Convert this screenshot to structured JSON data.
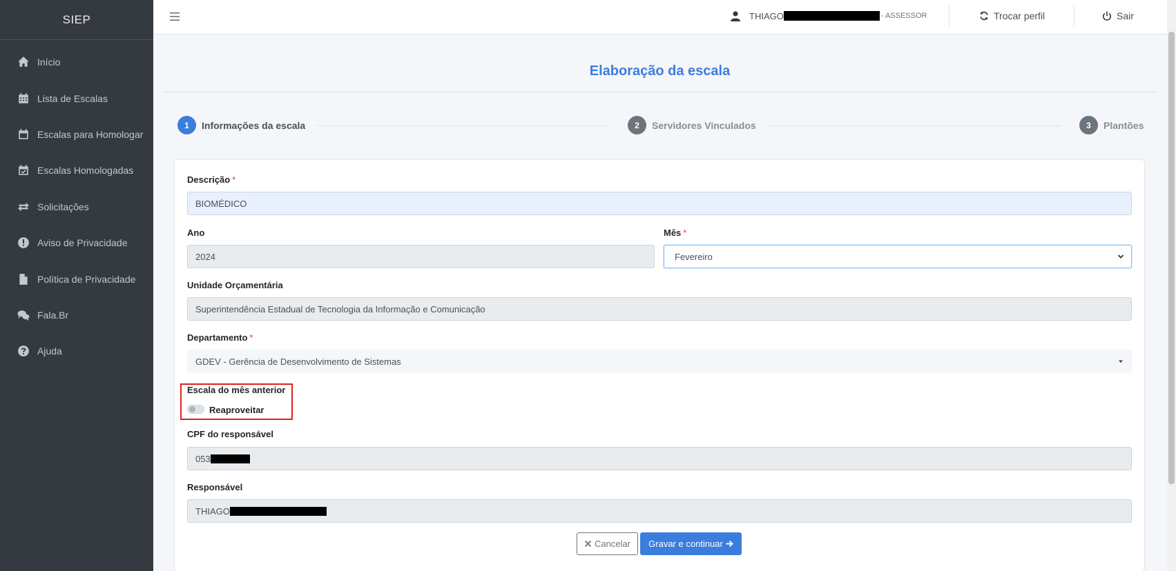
{
  "sidebar": {
    "brand": "SIEP",
    "items": [
      {
        "label": "Início",
        "icon": "home-icon"
      },
      {
        "label": "Lista de Escalas",
        "icon": "calendar-grid-icon"
      },
      {
        "label": "Escalas para Homologar",
        "icon": "calendar-icon"
      },
      {
        "label": "Escalas Homologadas",
        "icon": "calendar-check-icon"
      },
      {
        "label": "Solicitações",
        "icon": "exchange-arrows-icon"
      },
      {
        "label": "Aviso de Privacidade",
        "icon": "exclamation-circle-icon"
      },
      {
        "label": "Política de Privacidade",
        "icon": "file-icon"
      },
      {
        "label": "Fala.Br",
        "icon": "comments-icon"
      },
      {
        "label": "Ajuda",
        "icon": "question-circle-icon"
      }
    ]
  },
  "topbar": {
    "user_name": "THIAGO",
    "user_role": "- ASSESSOR",
    "switch_profile": "Trocar perfil",
    "logout": "Sair"
  },
  "page": {
    "title": "Elaboração da escala"
  },
  "steps": [
    {
      "number": "1",
      "label": "Informações da escala",
      "active": true
    },
    {
      "number": "2",
      "label": "Servidores Vinculados",
      "active": false
    },
    {
      "number": "3",
      "label": "Plantões",
      "active": false
    }
  ],
  "form": {
    "descricao_label": "Descrição",
    "descricao_value": "BIOMÉDICO",
    "ano_label": "Ano",
    "ano_value": "2024",
    "mes_label": "Mês",
    "mes_value": "Fevereiro",
    "unidade_label": "Unidade Orçamentária",
    "unidade_value": "Superintendência Estadual de Tecnologia da Informação e Comunicação",
    "departamento_label": "Departamento",
    "departamento_value": "GDEV - Gerência de Desenvolvimento de Sistemas",
    "escala_anterior_label": "Escala do mês anterior",
    "reaproveitar_label": "Reaproveitar",
    "reaproveitar_on": false,
    "cpf_label": "CPF do responsável",
    "cpf_value": "053",
    "responsavel_label": "Responsável",
    "responsavel_value": "THIAGO",
    "required_mark": "*"
  },
  "actions": {
    "cancel_label": "Cancelar",
    "save_label": "Gravar e continuar"
  },
  "colors": {
    "sidebar_bg": "#343a40",
    "accent": "#3b7ddd",
    "highlight_box": "#e02020",
    "required": "#dc3545"
  }
}
